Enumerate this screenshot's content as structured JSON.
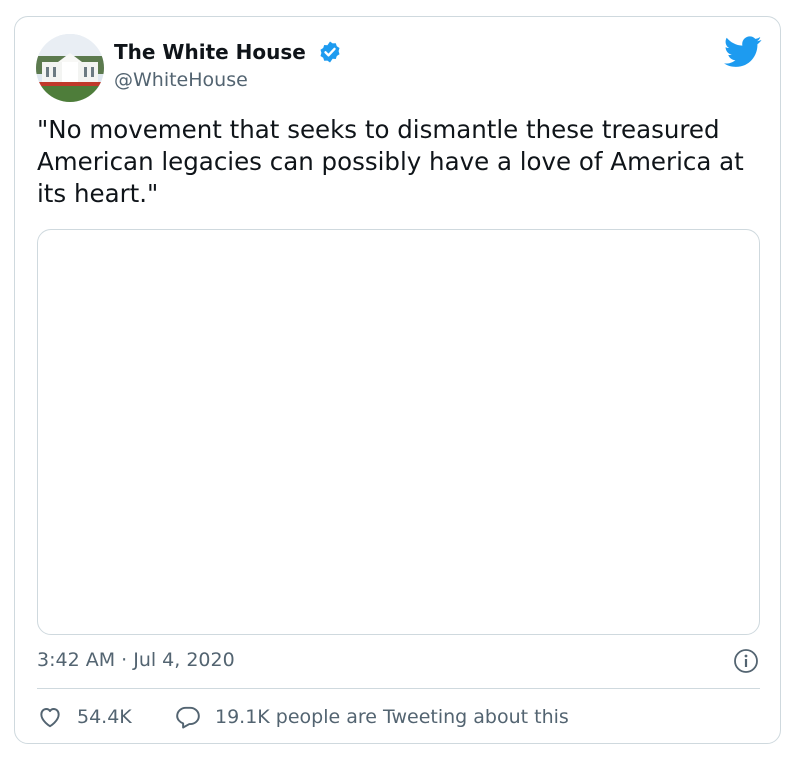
{
  "tweet": {
    "author": {
      "name": "The White House",
      "handle": "@WhiteHouse",
      "verified": true,
      "avatar_icon": "white-house-photo"
    },
    "text": "\"No movement that seeks to dismantle these treasured American legacies can possibly have a love of America at its heart.\"",
    "timestamp": "3:42 AM · Jul 4, 2020",
    "likes": "54.4K",
    "conversation": "19.1K people are Tweeting about this"
  },
  "colors": {
    "twitter_blue": "#1d9bf0",
    "secondary_text": "#536471",
    "border": "#cfd9de"
  }
}
